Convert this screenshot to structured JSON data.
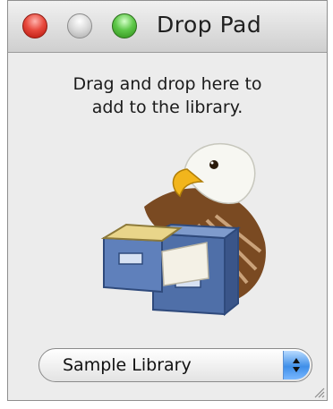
{
  "window": {
    "title": "Drop Pad",
    "controls": [
      "close",
      "minimize",
      "zoom"
    ]
  },
  "instruction": {
    "line1": "Drag and drop here to",
    "line2": "add to the library."
  },
  "artwork": {
    "icon": "eagle-file-cabinet-icon"
  },
  "library_select": {
    "selected": "Sample Library"
  },
  "colors": {
    "close": "#e84a3e",
    "minimize": "#c9c9c9",
    "zoom": "#5fc84a",
    "popup_accent": "#3f8fe9"
  }
}
